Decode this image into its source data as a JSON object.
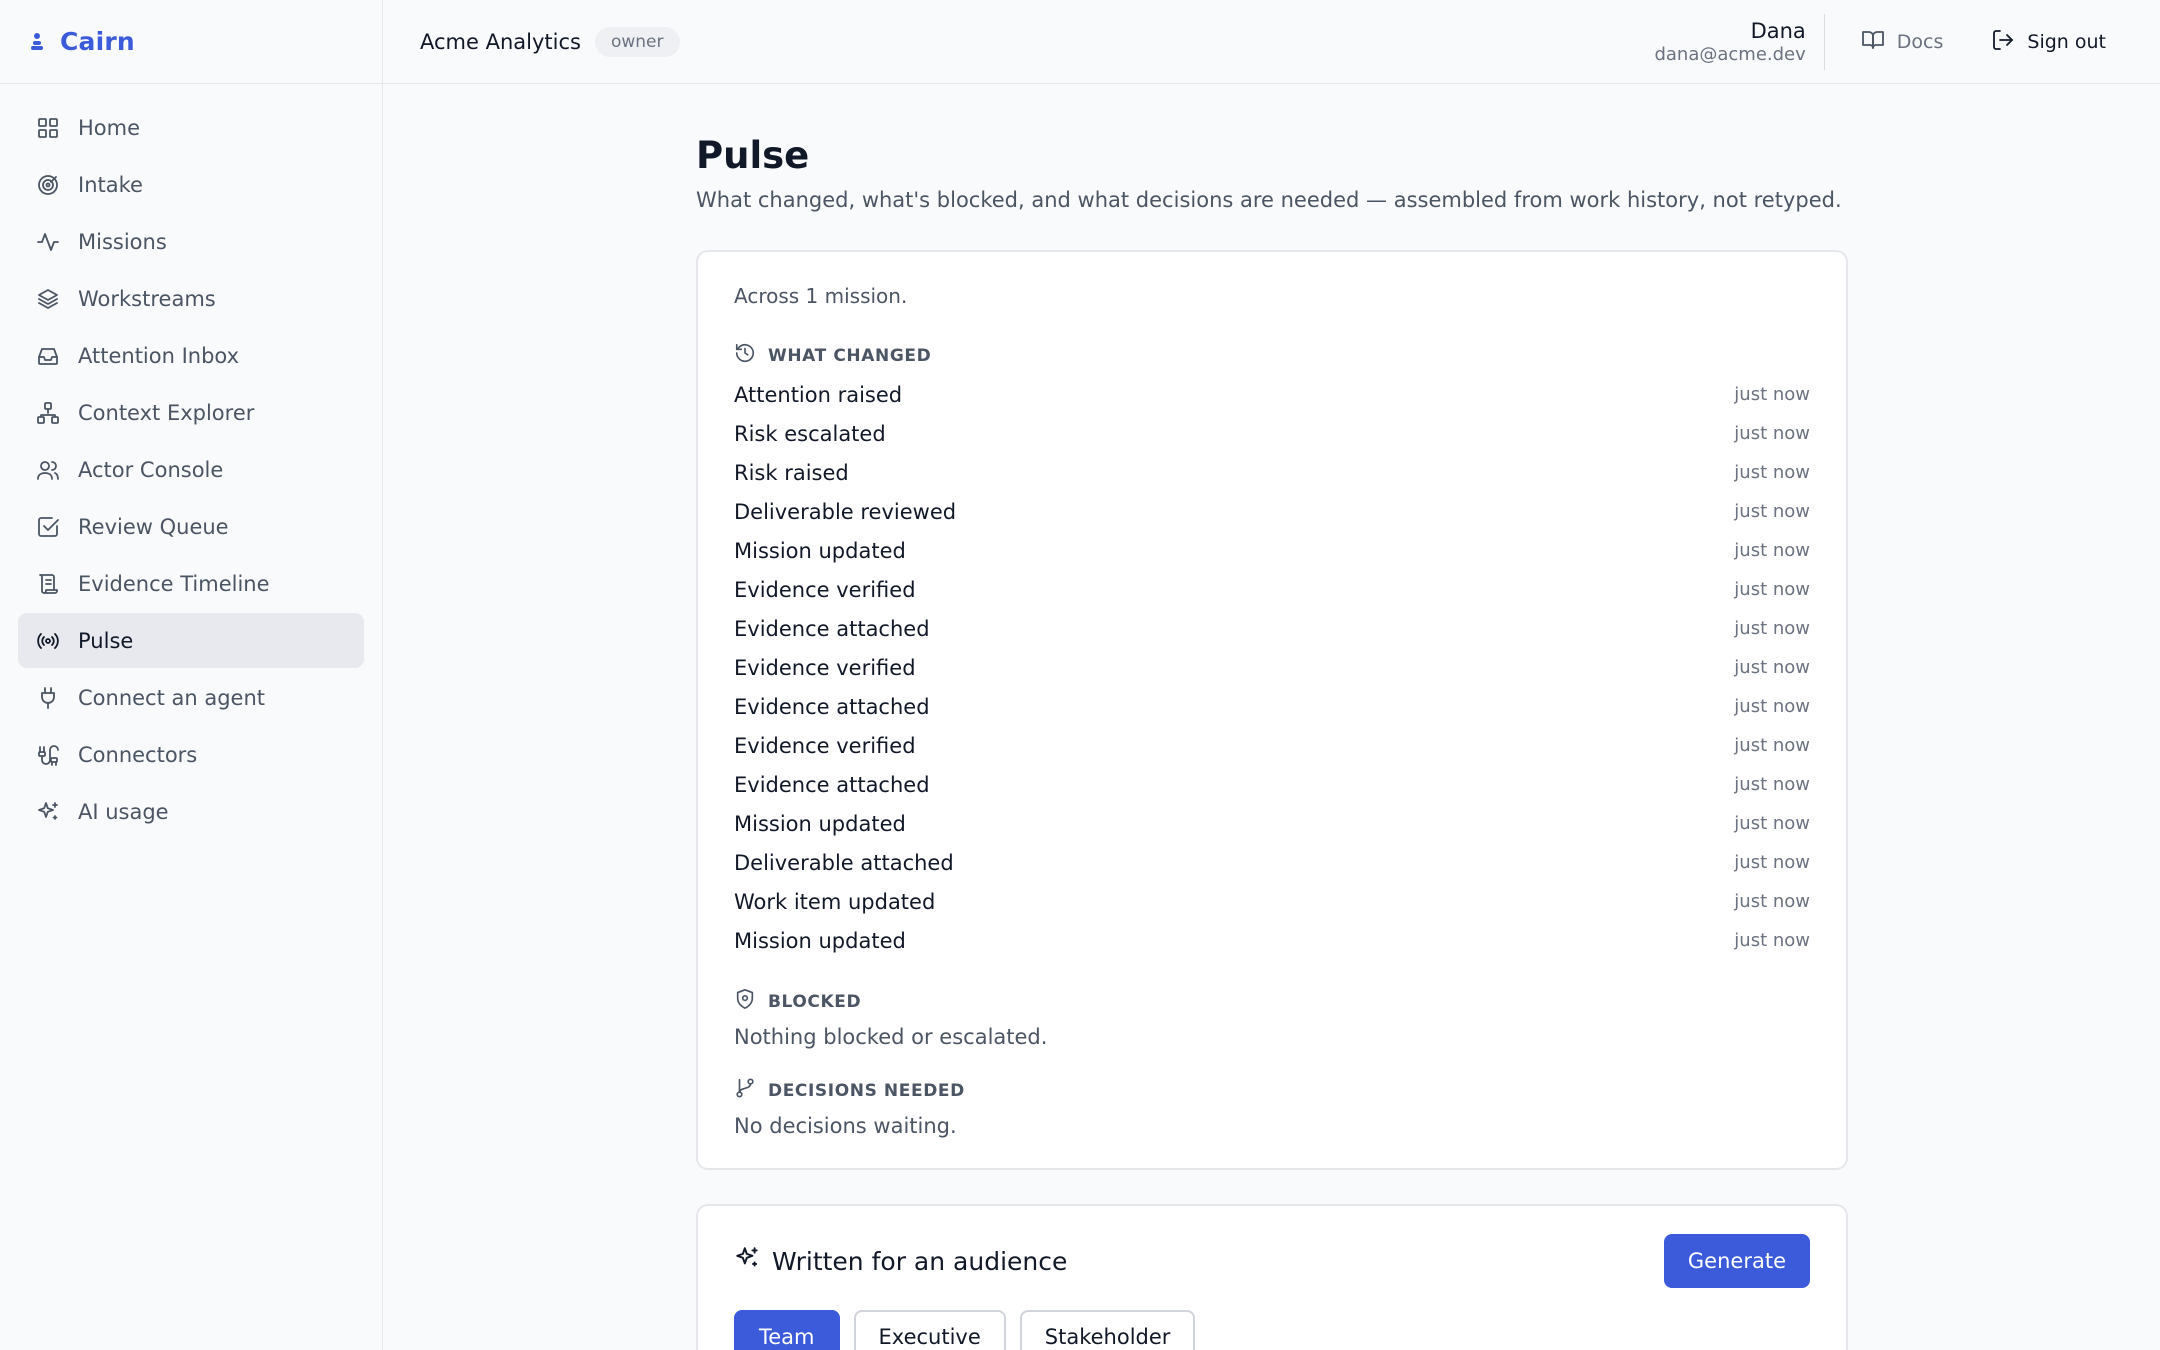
{
  "brand": {
    "name": "Cairn"
  },
  "sidebar": {
    "items": [
      {
        "label": "Home",
        "icon": "grid-icon"
      },
      {
        "label": "Intake",
        "icon": "target-icon"
      },
      {
        "label": "Missions",
        "icon": "activity-icon"
      },
      {
        "label": "Workstreams",
        "icon": "layers-icon"
      },
      {
        "label": "Attention Inbox",
        "icon": "inbox-icon"
      },
      {
        "label": "Context Explorer",
        "icon": "network-icon"
      },
      {
        "label": "Actor Console",
        "icon": "users-icon"
      },
      {
        "label": "Review Queue",
        "icon": "check-square-icon"
      },
      {
        "label": "Evidence Timeline",
        "icon": "scroll-icon"
      },
      {
        "label": "Pulse",
        "icon": "radio-icon",
        "active": true
      },
      {
        "label": "Connect an agent",
        "icon": "plug-icon"
      },
      {
        "label": "Connectors",
        "icon": "cable-icon"
      },
      {
        "label": "AI usage",
        "icon": "sparkles-icon"
      }
    ]
  },
  "topbar": {
    "org_name": "Acme Analytics",
    "role": "owner",
    "user_name": "Dana",
    "user_email": "dana@acme.dev",
    "docs_label": "Docs",
    "signout_label": "Sign out"
  },
  "page": {
    "title": "Pulse",
    "subtitle": "What changed, what's blocked, and what decisions are needed — assembled from work history, not retyped."
  },
  "pulse": {
    "summary": "Across 1 mission.",
    "what_changed": {
      "heading": "WHAT CHANGED",
      "items": [
        {
          "label": "Attention raised",
          "time": "just now"
        },
        {
          "label": "Risk escalated",
          "time": "just now"
        },
        {
          "label": "Risk raised",
          "time": "just now"
        },
        {
          "label": "Deliverable reviewed",
          "time": "just now"
        },
        {
          "label": "Mission updated",
          "time": "just now"
        },
        {
          "label": "Evidence verified",
          "time": "just now"
        },
        {
          "label": "Evidence attached",
          "time": "just now"
        },
        {
          "label": "Evidence verified",
          "time": "just now"
        },
        {
          "label": "Evidence attached",
          "time": "just now"
        },
        {
          "label": "Evidence verified",
          "time": "just now"
        },
        {
          "label": "Evidence attached",
          "time": "just now"
        },
        {
          "label": "Mission updated",
          "time": "just now"
        },
        {
          "label": "Deliverable attached",
          "time": "just now"
        },
        {
          "label": "Work item updated",
          "time": "just now"
        },
        {
          "label": "Mission updated",
          "time": "just now"
        }
      ]
    },
    "blocked": {
      "heading": "BLOCKED",
      "empty": "Nothing blocked or escalated."
    },
    "decisions": {
      "heading": "DECISIONS NEEDED",
      "empty": "No decisions waiting."
    }
  },
  "audience": {
    "title": "Written for an audience",
    "generate_label": "Generate",
    "options": [
      "Team",
      "Executive",
      "Stakeholder"
    ],
    "selected": "Team"
  },
  "colors": {
    "accent": "#3b5bdb",
    "sidebar_active": "#e8e9ee",
    "text_muted": "#6b7280"
  }
}
